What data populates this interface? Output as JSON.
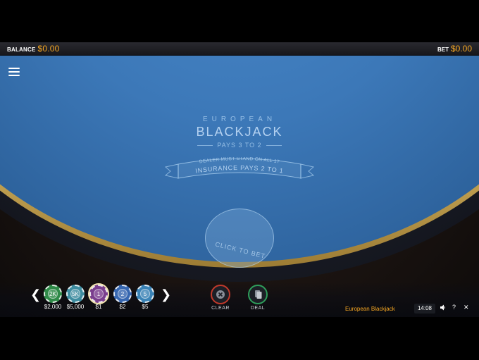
{
  "header": {
    "balance_label": "BALANCE",
    "balance_value": "$0.00",
    "bet_label": "BET",
    "bet_value": "$0.00"
  },
  "table": {
    "line1": "EUROPEAN",
    "line2": "BLACKJACK",
    "pays": "PAYS 3 TO 2",
    "dealer_rule": "DEALER MUST STAND ON ALL 17",
    "insurance": "INSURANCE PAYS 2 TO 1",
    "bet_spot_label": "CLICK TO BET"
  },
  "chips": [
    {
      "face": "2K",
      "label": "$2,000",
      "color": "#2f8a48"
    },
    {
      "face": "5K",
      "label": "$5,000",
      "color": "#3f8da0"
    },
    {
      "face": "1",
      "label": "$1",
      "color": "#7a3e8e",
      "selected": true
    },
    {
      "face": "2",
      "label": "$2",
      "color": "#3767b0"
    },
    {
      "face": "5",
      "label": "$5",
      "color": "#3b83b6"
    }
  ],
  "actions": {
    "clear_label": "CLEAR",
    "deal_label": "DEAL"
  },
  "status": {
    "game_name": "European Blackjack",
    "time": "14:08"
  },
  "colors": {
    "accent": "#f5a623",
    "felt": "#3c78b8",
    "clear_ring": "#c0392b",
    "deal_ring": "#2e9e5b"
  },
  "icons": {
    "menu": "hamburger-menu-icon",
    "prev": "chevron-left-icon",
    "next": "chevron-right-icon",
    "sound": "speaker-icon",
    "help": "question-icon",
    "close": "close-icon"
  }
}
